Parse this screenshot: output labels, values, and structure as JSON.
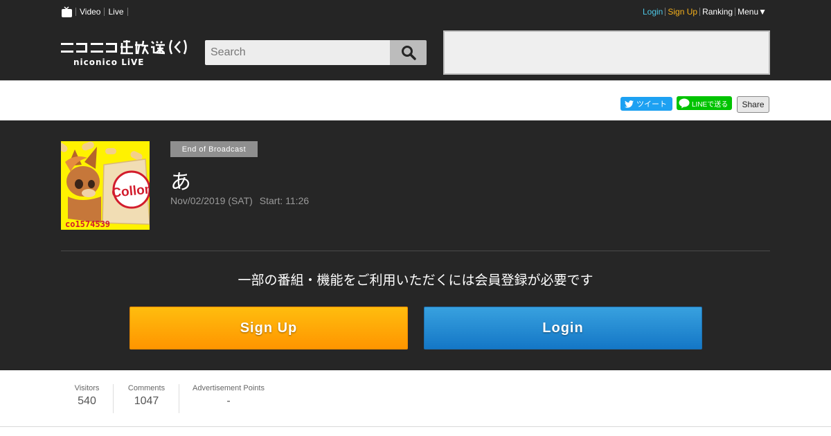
{
  "topnav": {
    "video": "Video",
    "live": "Live"
  },
  "usernav": {
    "login": "Login",
    "signup": "Sign Up",
    "ranking": "Ranking",
    "menu": "Menu▼"
  },
  "colors": {
    "login_accent": "#4ec7e6",
    "signup_accent": "#f6b01b",
    "signup_button": "#ff9e00",
    "login_button": "#1f88d0",
    "header_bg": "#252525"
  },
  "search": {
    "placeholder": "Search"
  },
  "share": {
    "tweet": "ツイート",
    "line": "LINEで送る",
    "share": "Share"
  },
  "program": {
    "status": "End of Broadcast",
    "title": "あ",
    "date": "Nov/02/2019 (SAT)",
    "start": "Start: 11:26",
    "thumbnail_text": "co1574539",
    "thumbnail_brand": "Collon"
  },
  "cta": {
    "notice": "一部の番組・機能をご利用いただくには会員登録が必要です",
    "signup": "Sign Up",
    "login": "Login"
  },
  "stats": [
    {
      "label": "Visitors",
      "value": "540"
    },
    {
      "label": "Comments",
      "value": "1047"
    },
    {
      "label": "Advertisement Points",
      "value": "-"
    }
  ]
}
